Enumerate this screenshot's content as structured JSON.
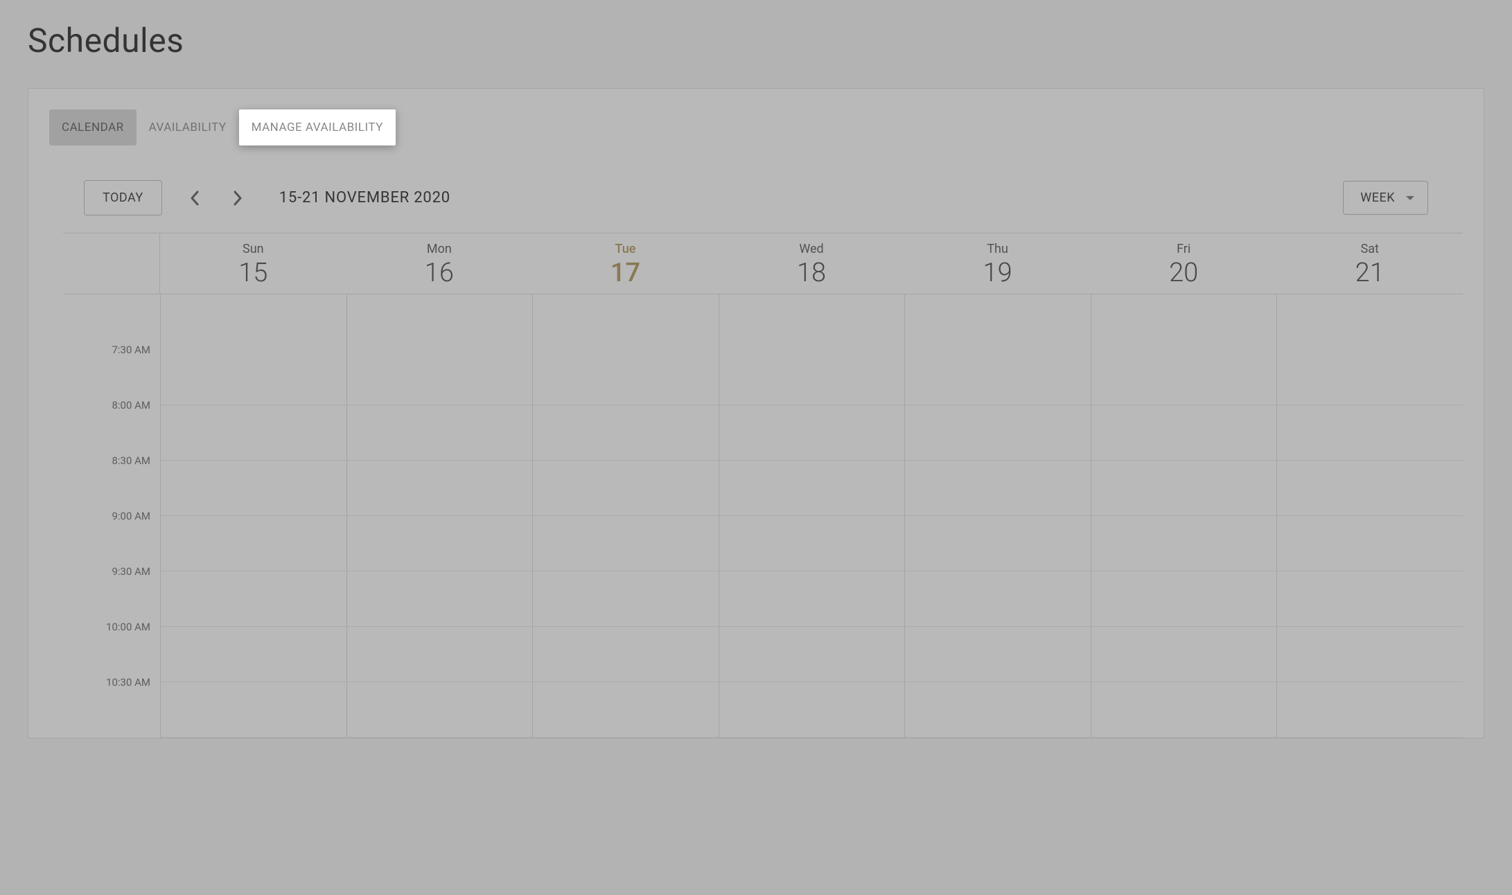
{
  "page_title": "Schedules",
  "tabs": [
    {
      "label": "CALENDAR",
      "state": "active"
    },
    {
      "label": "AVAILABILITY",
      "state": ""
    },
    {
      "label": "MANAGE AVAILABILITY",
      "state": "highlighted"
    }
  ],
  "toolbar": {
    "today_label": "TODAY",
    "date_range": "15-21 NOVEMBER 2020",
    "view_label": "WEEK"
  },
  "days": [
    {
      "name": "Sun",
      "num": "15",
      "today": false
    },
    {
      "name": "Mon",
      "num": "16",
      "today": false
    },
    {
      "name": "Tue",
      "num": "17",
      "today": true
    },
    {
      "name": "Wed",
      "num": "18",
      "today": false
    },
    {
      "name": "Thu",
      "num": "19",
      "today": false
    },
    {
      "name": "Fri",
      "num": "20",
      "today": false
    },
    {
      "name": "Sat",
      "num": "21",
      "today": false
    }
  ],
  "time_slots": [
    "7:30 AM",
    "8:00 AM",
    "8:30 AM",
    "9:00 AM",
    "9:30 AM",
    "10:00 AM",
    "10:30 AM"
  ]
}
